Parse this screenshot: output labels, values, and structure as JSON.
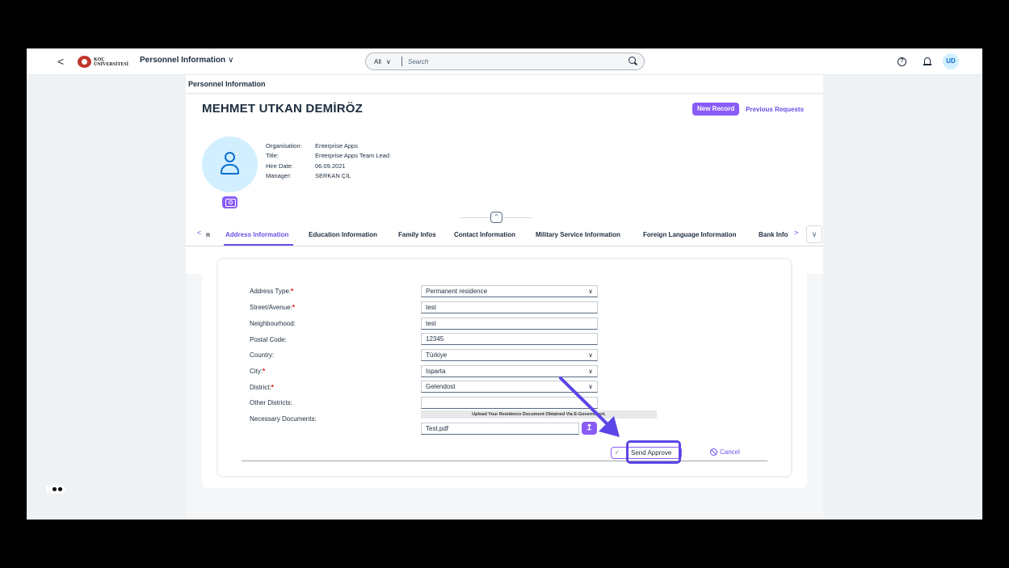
{
  "shell": {
    "back": "<",
    "logo_text_line1": "KOÇ",
    "logo_text_line2": "ÜNİVERSİTESİ",
    "app_title": "Personnel Information",
    "app_title_caret": "∨",
    "search_scope": "All",
    "search_scope_caret": "∨",
    "search_placeholder": "Search",
    "help_icon": "?",
    "user_initials": "UD"
  },
  "page": {
    "header_title": "Personnel Information",
    "employee_name": "MEHMET UTKAN DEMİRÖZ",
    "new_record": "New Record",
    "previous_requests": "Previous Requests",
    "attributes": [
      {
        "label": "Organisation:",
        "value": "Enterprise Apps"
      },
      {
        "label": "Title:",
        "value": "Enterprise Apps Team Lead"
      },
      {
        "label": "Hire Date:",
        "value": "06.09.2021"
      },
      {
        "label": "Manager:",
        "value": "SERKAN ÇİL"
      }
    ],
    "collapse_icon": "⌃"
  },
  "tabs": {
    "prev_arrow": "<",
    "prev_fragment": "n",
    "items": [
      {
        "label": "Address Information",
        "active": true
      },
      {
        "label": "Education Information"
      },
      {
        "label": "Family Infos"
      },
      {
        "label": "Contact Information"
      },
      {
        "label": "Military Service Information"
      },
      {
        "label": "Foreign Language Information"
      },
      {
        "label": "Bank Info"
      }
    ],
    "next_arrow": ">",
    "overflow": "∨"
  },
  "form": {
    "fields": [
      {
        "label": "Address Type:",
        "required": true,
        "value": "Permanent residence",
        "type": "select"
      },
      {
        "label": "Street/Avenue:",
        "required": true,
        "value": "test",
        "type": "input"
      },
      {
        "label": "Neighbourhood:",
        "required": false,
        "value": "test",
        "type": "input"
      },
      {
        "label": "Postal Code:",
        "required": false,
        "value": "12345",
        "type": "input"
      },
      {
        "label": "Country:",
        "required": false,
        "value": "Türkiye",
        "type": "select"
      },
      {
        "label": "City:",
        "required": true,
        "value": "Isparta",
        "type": "select"
      },
      {
        "label": "District:",
        "required": true,
        "value": "Gelendost",
        "type": "select"
      },
      {
        "label": "Other Districts:",
        "required": false,
        "value": "",
        "type": "input"
      },
      {
        "label": "Necessary Documents:",
        "required": false
      }
    ],
    "required_mark": "*",
    "dropdown_caret": "∨",
    "upload_note": "Upload Your Residence Document Obtained Via E-Government.",
    "file_name": "Test.pdf",
    "upload_icon": "↥",
    "send_approve": "Send Approve",
    "send_check": "✓",
    "cancel": "Cancel"
  },
  "colors": {
    "accent": "#8a5cf6",
    "accent_text": "#6b4ee6",
    "annotation": "#5b45e6"
  }
}
